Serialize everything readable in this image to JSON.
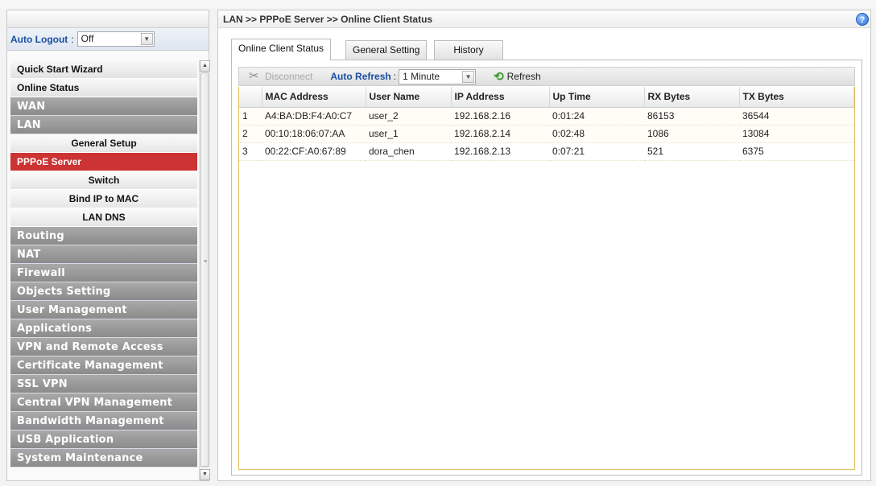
{
  "sidebar": {
    "autologout": {
      "label": "Auto Logout",
      "value": "Off"
    },
    "menu": [
      {
        "label": "Quick Start Wizard",
        "style": "light"
      },
      {
        "label": "Online Status",
        "style": "light"
      },
      {
        "label": "WAN",
        "style": "dark"
      },
      {
        "label": "LAN",
        "style": "dark"
      },
      {
        "label": "General Setup",
        "style": "sub"
      },
      {
        "label": "PPPoE Server",
        "style": "active"
      },
      {
        "label": "Switch",
        "style": "sub"
      },
      {
        "label": "Bind IP to MAC",
        "style": "sub"
      },
      {
        "label": "LAN DNS",
        "style": "sub"
      },
      {
        "label": "Routing",
        "style": "dark"
      },
      {
        "label": "NAT",
        "style": "dark"
      },
      {
        "label": "Firewall",
        "style": "dark"
      },
      {
        "label": "Objects Setting",
        "style": "dark"
      },
      {
        "label": "User Management",
        "style": "dark"
      },
      {
        "label": "Applications",
        "style": "dark"
      },
      {
        "label": "VPN and Remote Access",
        "style": "dark"
      },
      {
        "label": "Certificate Management",
        "style": "dark"
      },
      {
        "label": "SSL VPN",
        "style": "dark"
      },
      {
        "label": "Central VPN Management",
        "style": "dark"
      },
      {
        "label": "Bandwidth Management",
        "style": "dark"
      },
      {
        "label": "USB Application",
        "style": "dark"
      },
      {
        "label": "System Maintenance",
        "style": "dark"
      }
    ]
  },
  "header": {
    "breadcrumb": "LAN >> PPPoE Server >> Online Client Status",
    "help_icon": "question-mark"
  },
  "tabs": [
    "Online Client Status",
    "General Setting",
    "History"
  ],
  "toolbar": {
    "disconnect_label": "Disconnect",
    "auto_refresh_label": "Auto Refresh",
    "auto_refresh_value": "1 Minute",
    "refresh_label": "Refresh"
  },
  "table": {
    "columns": [
      "",
      "MAC Address",
      "User Name",
      "IP Address",
      "Up Time",
      "RX Bytes",
      "TX Bytes"
    ],
    "rows": [
      [
        "1",
        "A4:BA:DB:F4:A0:C7",
        "user_2",
        "192.168.2.16",
        "0:01:24",
        "86153",
        "36544"
      ],
      [
        "2",
        "00:10:18:06:07:AA",
        "user_1",
        "192.168.2.14",
        "0:02:48",
        "1086",
        "13084"
      ],
      [
        "3",
        "00:22:CF:A0:67:89",
        "dora_chen",
        "192.168.2.13",
        "0:07:21",
        "521",
        "6375"
      ]
    ]
  },
  "colors": {
    "active_menu": "#cc3333",
    "label_blue": "#1a4fa0",
    "refresh_green": "#3b9a2e"
  }
}
